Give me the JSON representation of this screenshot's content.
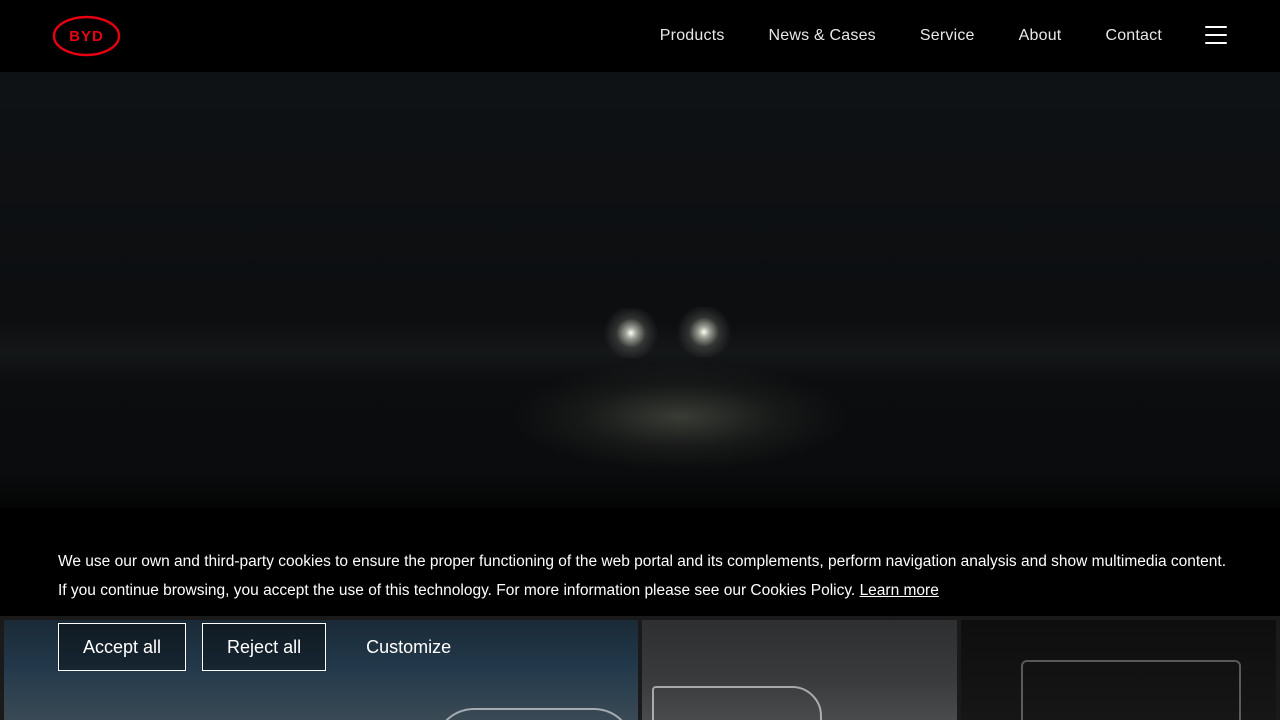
{
  "header": {
    "logo_text": "BYD",
    "logo_color": "#e60012",
    "nav": [
      {
        "label": "Products"
      },
      {
        "label": "News & Cases"
      },
      {
        "label": "Service"
      },
      {
        "label": "About"
      },
      {
        "label": "Contact"
      }
    ],
    "menu_icon": "hamburger-menu-icon"
  },
  "cookie_banner": {
    "text": "We use our own and third-party cookies to ensure the proper functioning of the web portal and its complements, perform navigation analysis and show multimedia content. If you continue browsing, you accept the use of this technology. For more information please see our Cookies Policy.",
    "learn_more": "Learn more",
    "accept_label": "Accept all",
    "reject_label": "Reject all",
    "customize_label": "Customize"
  }
}
